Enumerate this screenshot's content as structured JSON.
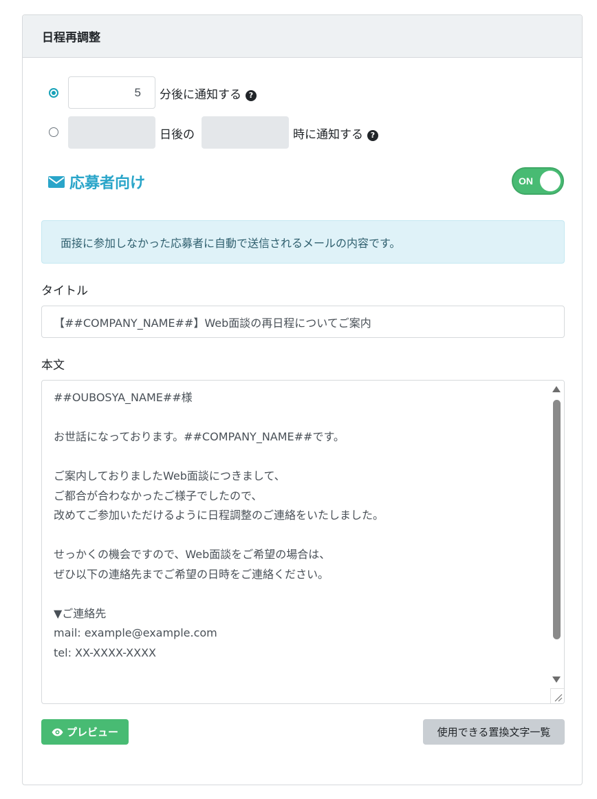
{
  "header": {
    "title": "日程再調整"
  },
  "schedule": {
    "option_minutes": {
      "selected": true,
      "value": "5",
      "suffix": "分後に通知する"
    },
    "option_days": {
      "selected": false,
      "days_value": "",
      "middle": "日後の",
      "time_value": "",
      "suffix": "時に通知する"
    },
    "help_glyph": "?"
  },
  "applicant": {
    "title": "応募者向け",
    "icon": "envelope-icon",
    "toggle_label": "ON",
    "toggle_on": true,
    "toggle_color": "#48bb73",
    "title_color": "#2aa5c9"
  },
  "notice": {
    "text": "面接に参加しなかった応募者に自動で送信されるメールの内容です。"
  },
  "title_field": {
    "label": "タイトル",
    "value": "【##COMPANY_NAME##】Web面談の再日程についてご案内"
  },
  "body_field": {
    "label": "本文",
    "value": "##OUBOSYA_NAME##様\n\nお世話になっております。##COMPANY_NAME##です。\n\nご案内しておりましたWeb面談につきまして、\nご都合が合わなかったご様子でしたので、\n改めてご参加いただけるように日程調整のご連絡をいたしました。\n\nせっかくの機会ですので、Web面談をご希望の場合は、\nぜひ以下の連絡先までご希望の日時をご連絡ください。\n\n▼ご連絡先\nmail: example@example.com\ntel: XX-XXXX-XXXX\n\n\nなお、ご不明点がございましたら、お気軽にお問い合わせください。"
  },
  "buttons": {
    "preview_label": "プレビュー",
    "preview_icon": "eye-icon",
    "placeholders_label": "使用できる置換文字一覧"
  }
}
